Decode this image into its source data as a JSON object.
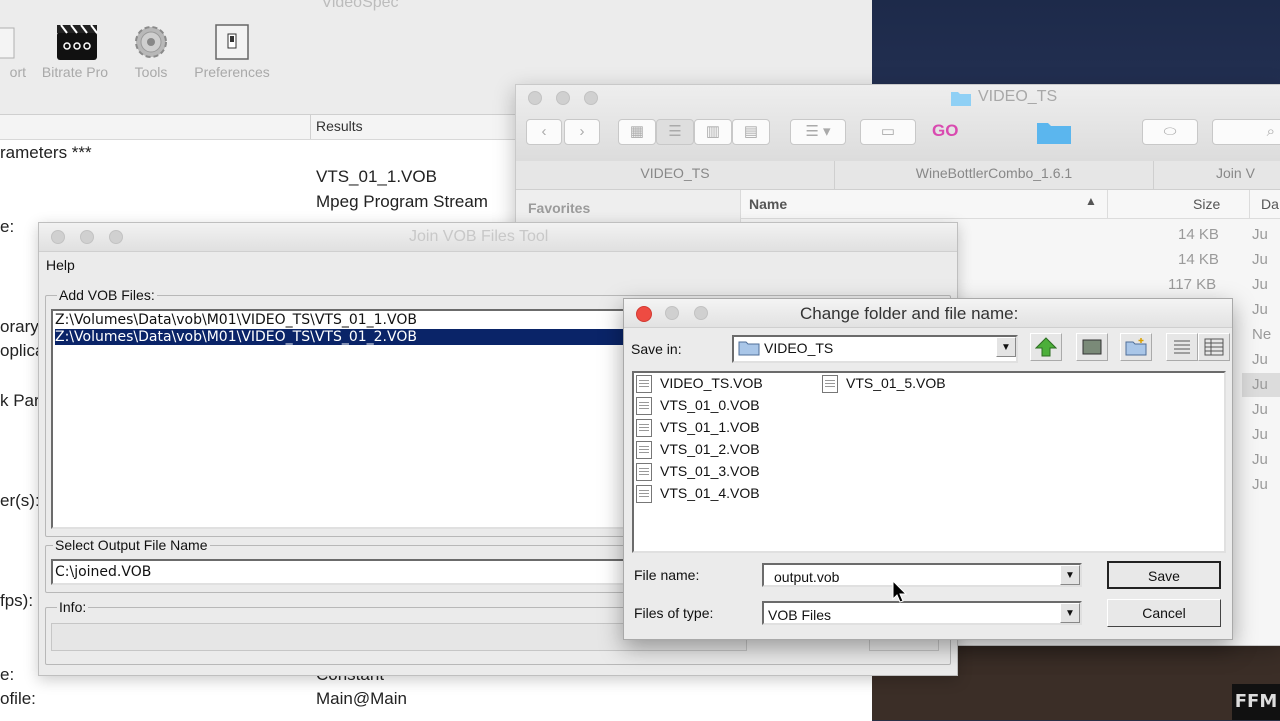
{
  "videospec": {
    "title": "VideoSpec",
    "toolbar": {
      "export_label": "ort",
      "bitrate_label": "Bitrate Pro",
      "tools_label": "Tools",
      "preferences_label": "Preferences"
    },
    "table": {
      "results_header": "Results",
      "rows_left": [
        "rameters ***",
        "e:",
        "orary",
        "oplica",
        "k Par",
        "er(s):",
        "fps):",
        "e:",
        "ofile:"
      ],
      "rows_right": [
        "VTS_01_1.VOB",
        "Mpeg Program Stream",
        "Constant",
        "Main@Main"
      ]
    }
  },
  "finder": {
    "title": "VIDEO_TS",
    "go_label": "GO",
    "tabs": [
      "VIDEO_TS",
      "WineBottlerCombo_1.6.1",
      "Join V"
    ],
    "sidebar_favorites": "Favorites",
    "columns": {
      "name": "Name",
      "size": "Size",
      "date": "Da"
    },
    "sizes": [
      "14 KB",
      "14 KB",
      "117 KB"
    ],
    "dates": [
      "Ju",
      "Ju",
      "Ju",
      "Ju",
      "Ne",
      "Ju",
      "Ju",
      "Ju",
      "Ju",
      "Ju",
      "Ju"
    ]
  },
  "joinvob": {
    "title": "Join VOB Files Tool",
    "menu_help": "Help",
    "add_label": "Add VOB Files:",
    "files": [
      "Z:\\Volumes\\Data\\vob\\M01\\VIDEO_TS\\VTS_01_1.VOB",
      "Z:\\Volumes\\Data\\vob\\M01\\VIDEO_TS\\VTS_01_2.VOB"
    ],
    "selected_index": 1,
    "output_label": "Select Output File Name",
    "output_value": "C:\\joined.VOB",
    "info_label": "Info:"
  },
  "savedialog": {
    "title": "Change folder and file name:",
    "save_in_label": "Save in:",
    "save_in_value": "VIDEO_TS",
    "files_col1": [
      "VIDEO_TS.VOB",
      "VTS_01_0.VOB",
      "VTS_01_1.VOB",
      "VTS_01_2.VOB",
      "VTS_01_3.VOB",
      "VTS_01_4.VOB"
    ],
    "files_col2": [
      "VTS_01_5.VOB"
    ],
    "file_name_label": "File name:",
    "file_name_value": "output.vob",
    "file_type_label": "Files of type:",
    "file_type_value": "VOB Files",
    "save_button": "Save",
    "cancel_button": "Cancel"
  },
  "watermark": "FFM",
  "colors": {
    "close_red": "#ee4b42",
    "selection_blue": "#0a2468",
    "go_pink": "#d94ab0",
    "folder_blue": "#5bb6ee"
  }
}
